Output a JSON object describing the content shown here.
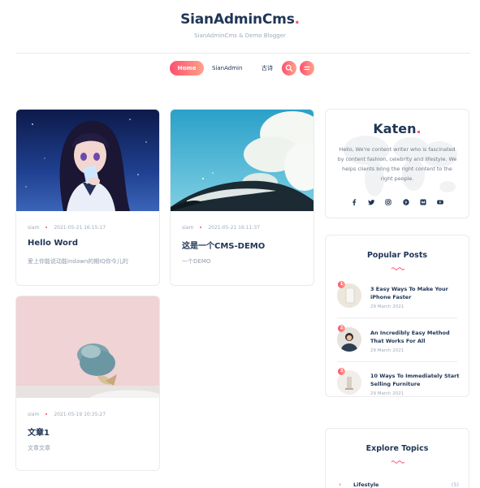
{
  "header": {
    "brand": "SianAdminCms",
    "brand_dot": ".",
    "tagline": "SianAdminCms & Demo Blogger"
  },
  "nav": {
    "items": [
      {
        "label": "Home",
        "active": true
      },
      {
        "label": "SianAdmin",
        "active": false
      },
      {
        "label": "古诗",
        "active": false
      }
    ],
    "search_icon": "search-icon",
    "menu_icon": "hamburger-icon"
  },
  "posts": [
    {
      "author": "siam",
      "date": "2021-05-21 16:15:17",
      "title": "Hello Word",
      "excerpt": "爱上你能说动能indawn的期IQ你今儿的"
    },
    {
      "author": "siam",
      "date": "2021-05-21 16:11:37",
      "title": "这是一个CMS-DEMO",
      "excerpt": "一个DEMO"
    },
    {
      "author": "siam",
      "date": "2021-05-19 10:35:27",
      "title": "文章1",
      "excerpt": "文章文章"
    }
  ],
  "about": {
    "name": "Katen",
    "name_dot": ".",
    "text": "Hello, We're content writer who is fascinated by content fashion, celebrity and lifestyle. We helps clients bring the right content to the right people.",
    "social_icons": [
      "facebook-icon",
      "twitter-icon",
      "instagram-icon",
      "pinterest-icon",
      "medium-icon",
      "youtube-icon"
    ]
  },
  "popular": {
    "title": "Popular Posts",
    "items": [
      {
        "num": "1",
        "title": "3 Easy Ways To Make Your iPhone Faster",
        "date": "29 March 2021"
      },
      {
        "num": "2",
        "title": "An Incredibly Easy Method That Works For All",
        "date": "29 March 2021"
      },
      {
        "num": "3",
        "title": "10 Ways To Immediately Start Selling Furniture",
        "date": "29 March 2021"
      }
    ]
  },
  "topics": {
    "title": "Explore Topics",
    "items": [
      {
        "name": "Lifestyle",
        "count": "(5)"
      }
    ]
  },
  "colors": {
    "accent": "#fe4f70",
    "accent_end": "#ffa387",
    "heading": "#203656",
    "muted": "#9faabb",
    "border": "#ebebeb"
  }
}
